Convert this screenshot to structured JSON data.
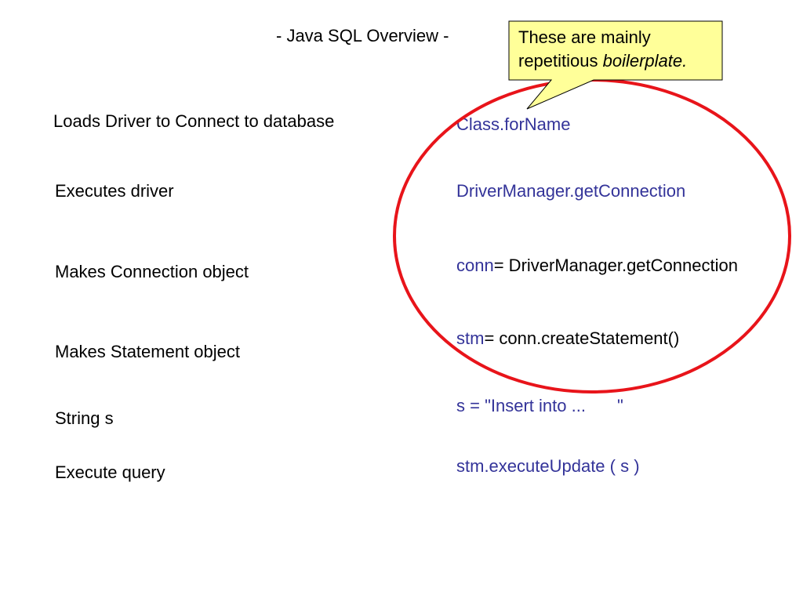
{
  "slide": {
    "title": "- Java SQL Overview -",
    "callout": {
      "line1": "These are mainly",
      "line2_plain": "repetitious ",
      "line2_italic": "boilerplate."
    },
    "rows": [
      {
        "description": "Loads Driver to Connect to database",
        "code_blue": "Class.forName",
        "code_black": ""
      },
      {
        "description": "Executes driver",
        "code_blue": "DriverManager.getConnection",
        "code_black": ""
      },
      {
        "description": "Makes Connection object",
        "code_blue": "conn",
        "code_black": "= DriverManager.getConnection"
      },
      {
        "description": "Makes Statement object",
        "code_blue": "stm",
        "code_black": "= conn.createStatement()"
      },
      {
        "description": "String s",
        "code_blue_start": "s = \"Insert into ...",
        "code_blue_end": "\""
      },
      {
        "description": "Execute query",
        "code_blue": "stm.executeUpdate ( s )",
        "code_black": ""
      }
    ],
    "colors": {
      "code_blue": "#333399",
      "callout_fill": "#ffff99",
      "ellipse_stroke": "#e8141a"
    }
  }
}
